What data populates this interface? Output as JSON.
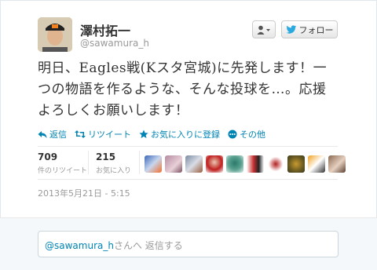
{
  "profile": {
    "display_name": "澤村拓一",
    "handle": "@sawamura_h"
  },
  "header": {
    "user_menu_icon": "user-dropdown-icon",
    "follow_label": "フォロー"
  },
  "tweet": {
    "text": "明日、Eagles戦(Kスタ宮城)に先発します！一つの物語を作るような、そんな投球を…。応援よろしくお願いします！"
  },
  "actions": [
    {
      "label": "返信",
      "icon": "reply-icon"
    },
    {
      "label": "リツイート",
      "icon": "retweet-icon"
    },
    {
      "label": "お気に入りに登録",
      "icon": "star-icon"
    },
    {
      "label": "その他",
      "icon": "more-icon"
    }
  ],
  "stats": {
    "retweets": {
      "count": "709",
      "label": "件のリツイート"
    },
    "favorites": {
      "count": "215",
      "label": "お気に入り"
    }
  },
  "timestamp": "2013年5月21日 - 5:15",
  "reply": {
    "mention": "@sawamura_h",
    "suffix": "さんへ 返信する"
  },
  "colors": {
    "link": "#0084b4",
    "muted": "#999999",
    "text": "#333333"
  }
}
